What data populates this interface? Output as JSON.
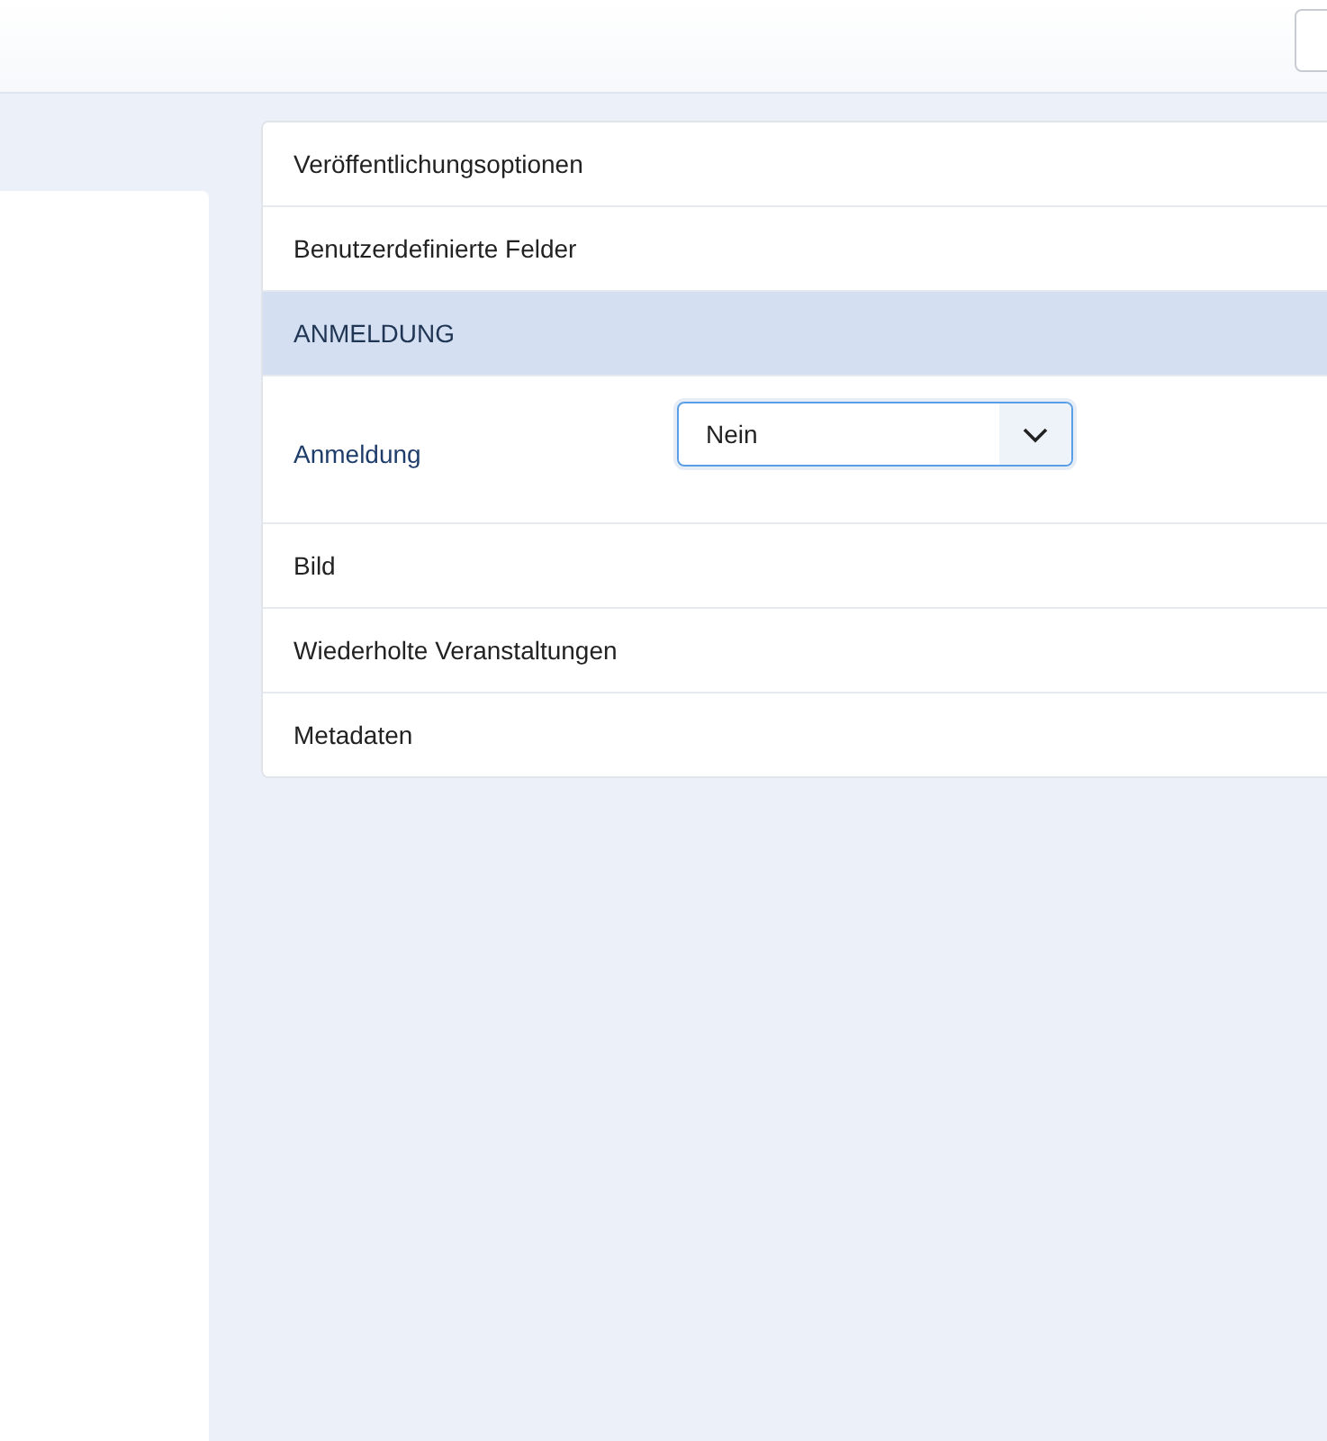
{
  "sections": [
    {
      "label": "Veröffentlichungsoptionen",
      "expanded": false
    },
    {
      "label": "Benutzerdefinierte Felder",
      "expanded": false
    },
    {
      "label": "ANMELDUNG",
      "expanded": true,
      "field": {
        "label": "Anmeldung",
        "value": "Nein"
      }
    },
    {
      "label": "Bild",
      "expanded": false
    },
    {
      "label": "Wiederholte Veranstaltungen",
      "expanded": false
    },
    {
      "label": "Metadaten",
      "expanded": false
    }
  ]
}
